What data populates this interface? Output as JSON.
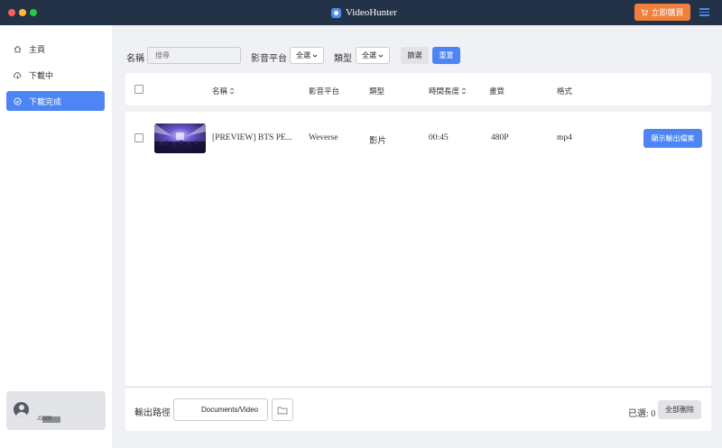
{
  "app": {
    "title": "VideoHunter",
    "buy_label": "立即購買"
  },
  "sidebar": {
    "items": [
      {
        "label": "主頁",
        "icon": "home-icon",
        "active": false
      },
      {
        "label": "下載中",
        "icon": "cloud-download-icon",
        "active": false
      },
      {
        "label": "下載完成",
        "icon": "check-circle-icon",
        "active": true
      }
    ],
    "user": {
      "email": ".com"
    }
  },
  "filters": {
    "name_label": "名稱",
    "search_placeholder": "搜尋",
    "platform_label": "影音平台",
    "platform_value": "全選",
    "type_label": "類型",
    "type_value": "全選",
    "filter_button": "篩選",
    "reset_button": "重置"
  },
  "table": {
    "columns": [
      "名稱",
      "影音平台",
      "類型",
      "時間長度",
      "畫質",
      "格式"
    ],
    "rows": [
      {
        "title": "[PREVIEW] BTS PE...",
        "platform": "Weverse",
        "type": "影片",
        "duration": "00:45",
        "quality": "480P",
        "format": "mp4",
        "action": "顯示輸出檔案"
      }
    ]
  },
  "footer": {
    "output_label": "輸出路徑",
    "output_path": "Documents/Video",
    "selected_label": "已選: 0",
    "delete_all": "全部刪除"
  },
  "colors": {
    "titlebar": "#243247",
    "accent": "#4d86f4",
    "buy": "#f07f3c"
  }
}
